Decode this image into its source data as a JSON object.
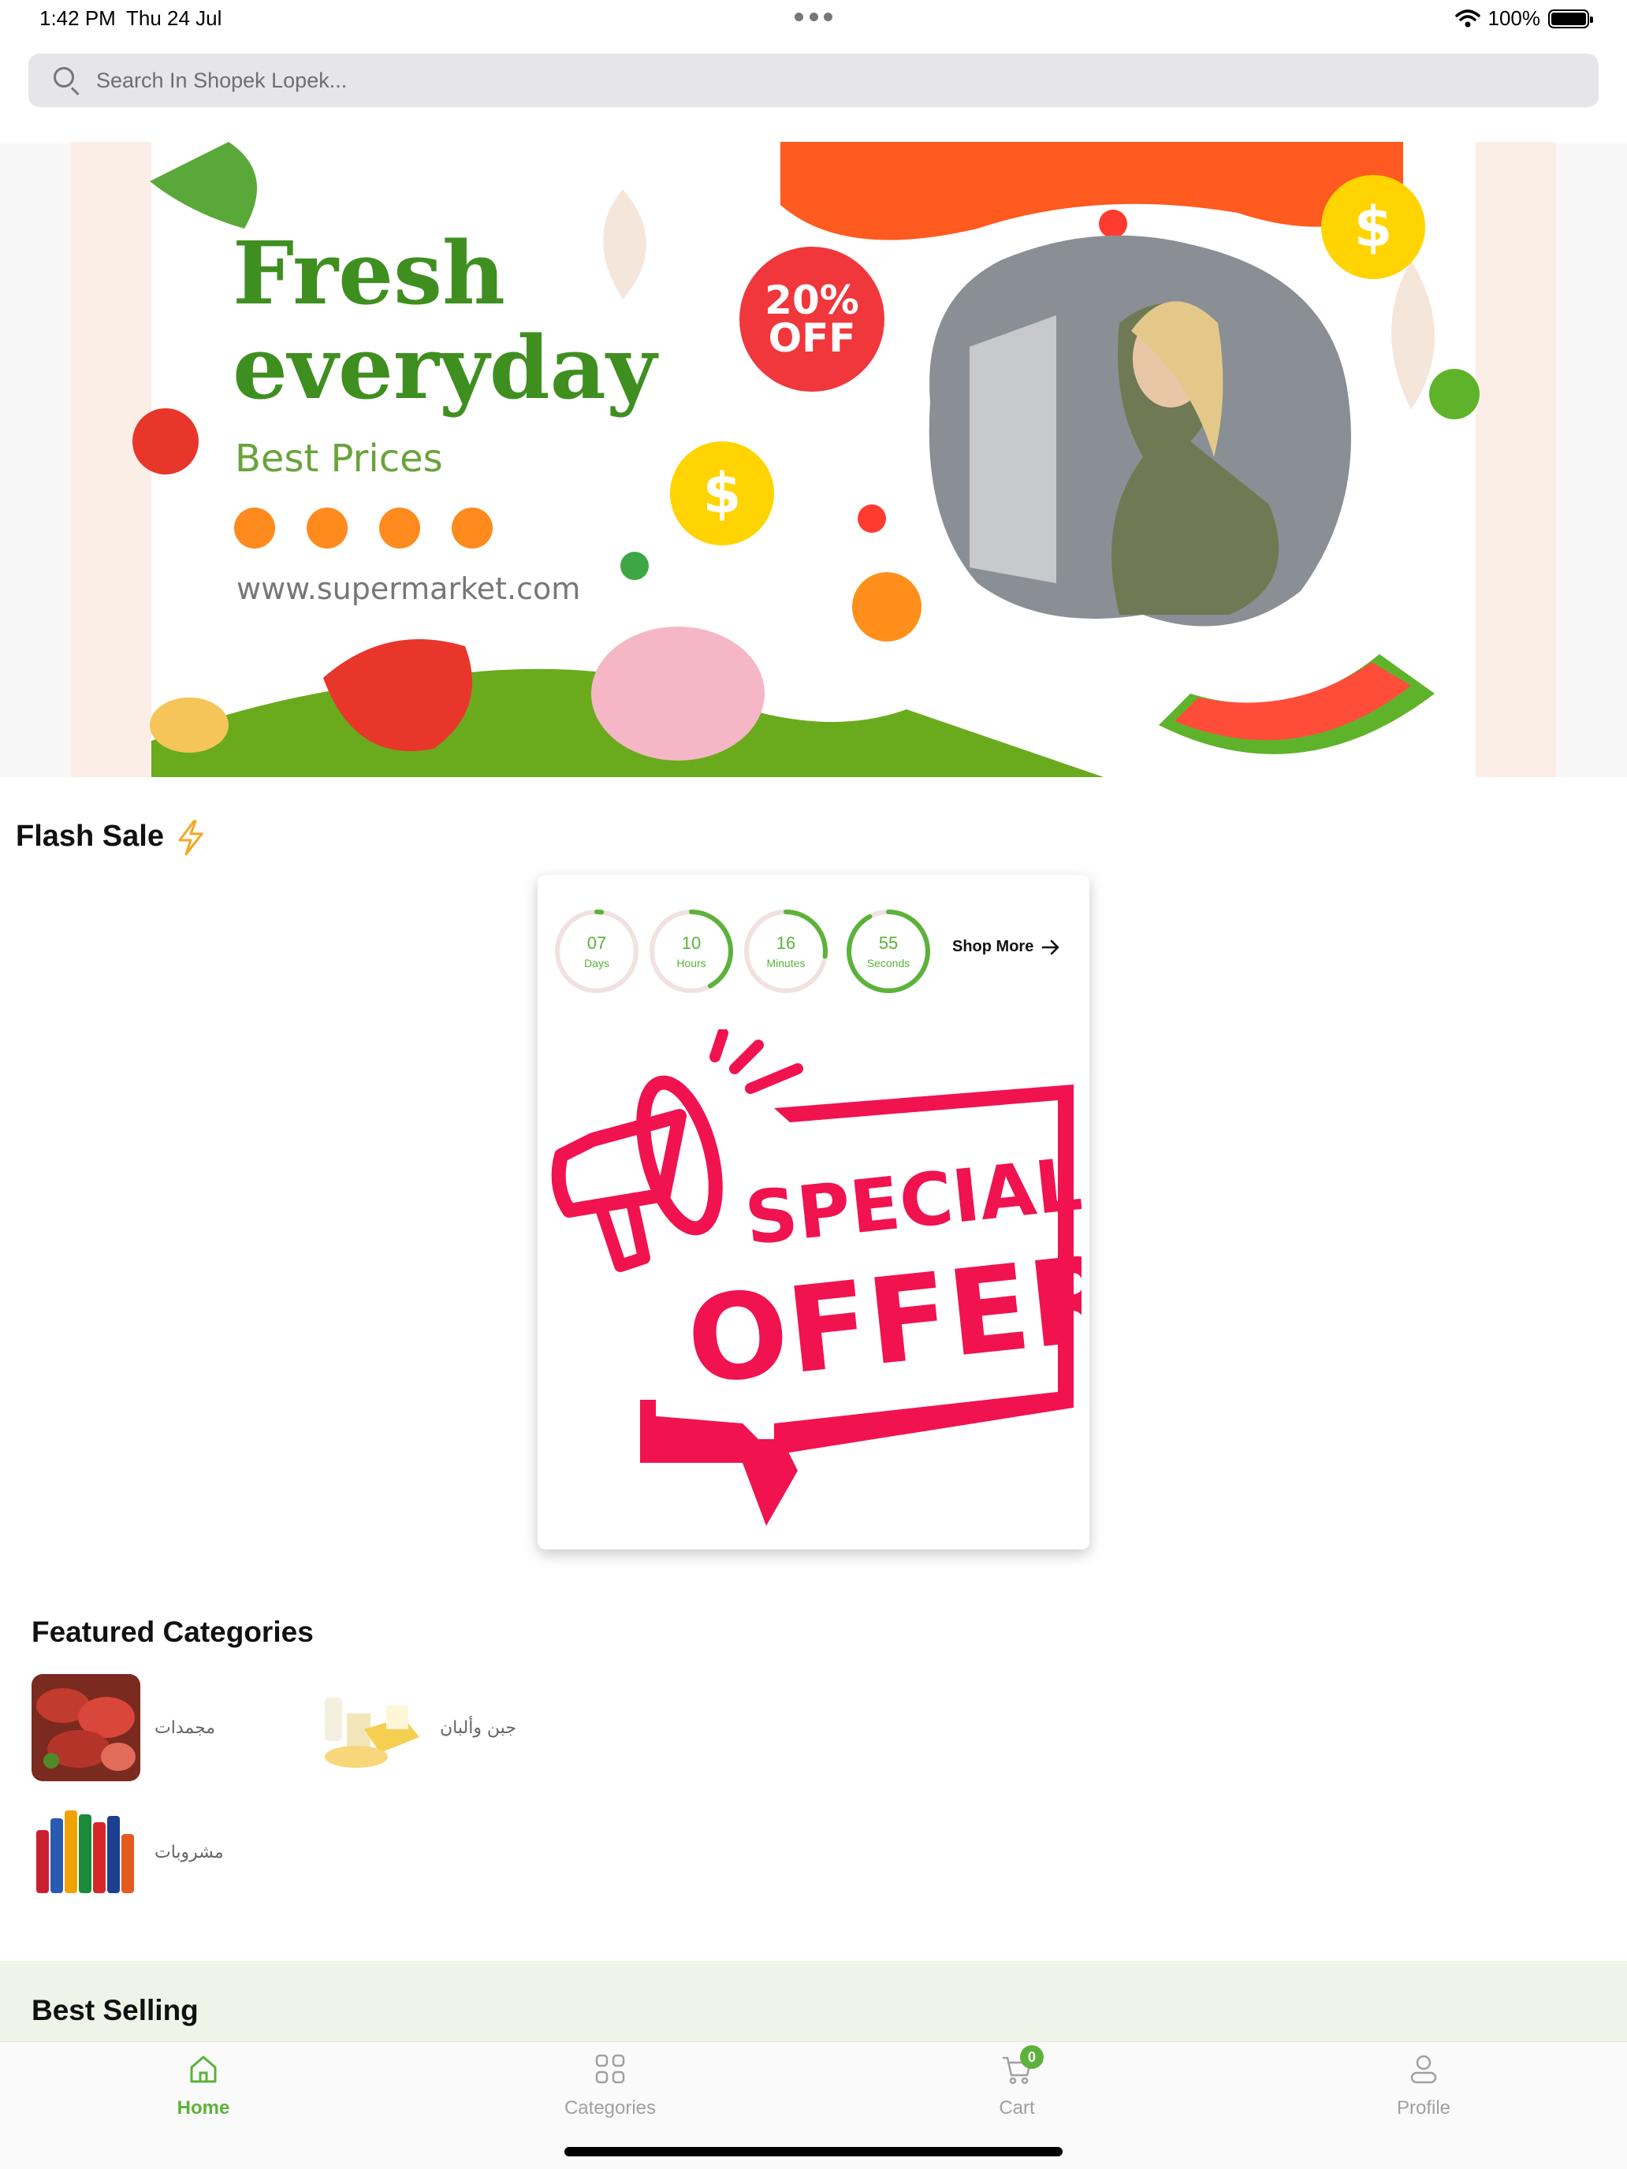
{
  "status_bar": {
    "time": "1:42 PM",
    "date": "Thu 24 Jul",
    "battery": "100%"
  },
  "search": {
    "placeholder": "Search In Shopek Lopek..."
  },
  "banner": {
    "headline_1": "Fresh",
    "headline_2": "everyday",
    "subline": "Best Prices",
    "discount_1": "20%",
    "discount_2": "OFF",
    "url": "www.supermarket.com",
    "currency_symbol": "$"
  },
  "flash_sale": {
    "title": "Flash Sale",
    "timers": [
      {
        "value": "07",
        "unit": "Days",
        "fraction": 0.02
      },
      {
        "value": "10",
        "unit": "Hours",
        "fraction": 0.42
      },
      {
        "value": "16",
        "unit": "Minutes",
        "fraction": 0.27
      },
      {
        "value": "55",
        "unit": "Seconds",
        "fraction": 0.92
      }
    ],
    "shop_more": "Shop More",
    "offer_line_1": "SPECIAL",
    "offer_line_2": "OFFER"
  },
  "featured_categories": {
    "title": "Featured Categories",
    "items": [
      {
        "label": "مجمدات"
      },
      {
        "label": "جبن وألبان"
      },
      {
        "label": "مشروبات"
      }
    ]
  },
  "best_selling": {
    "title": "Best Selling"
  },
  "tab_bar": {
    "items": [
      {
        "label": "Home"
      },
      {
        "label": "Categories"
      },
      {
        "label": "Cart"
      },
      {
        "label": "Profile"
      }
    ],
    "cart_count": "0"
  },
  "colors": {
    "accent": "#5cb23a",
    "offer_red": "#f0134f",
    "banner_green": "#3f8f20",
    "banner_orange": "#ff5a1f"
  }
}
